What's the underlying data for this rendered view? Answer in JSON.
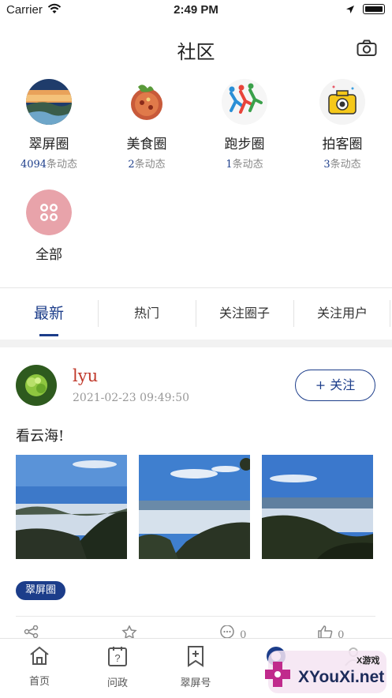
{
  "status": {
    "carrier": "Carrier",
    "time": "2:49 PM"
  },
  "nav": {
    "title": "社区",
    "camera_icon": "camera-icon"
  },
  "circles": [
    {
      "name": "翠屏圈",
      "count": "4094",
      "suffix": "条动态"
    },
    {
      "name": "美食圈",
      "count": "2",
      "suffix": "条动态"
    },
    {
      "name": "跑步圈",
      "count": "1",
      "suffix": "条动态"
    },
    {
      "name": "拍客圈",
      "count": "3",
      "suffix": "条动态"
    },
    {
      "name": "全部"
    }
  ],
  "tabs": [
    "最新",
    "热门",
    "关注圈子",
    "关注用户"
  ],
  "post": {
    "user": "lyu",
    "timestamp": "2021-02-23 09:49:50",
    "follow_label": "+ 关注",
    "text": "看云海!",
    "tag": "翠屏圈",
    "comment_count": "0",
    "like_count": "0"
  },
  "tabbar": [
    "首页",
    "问政",
    "翠屏号"
  ],
  "watermark": {
    "main": "XYouXi.net",
    "small": "X游戏"
  },
  "colors": {
    "accent": "#1c3d8a",
    "username": "#c0392b"
  }
}
